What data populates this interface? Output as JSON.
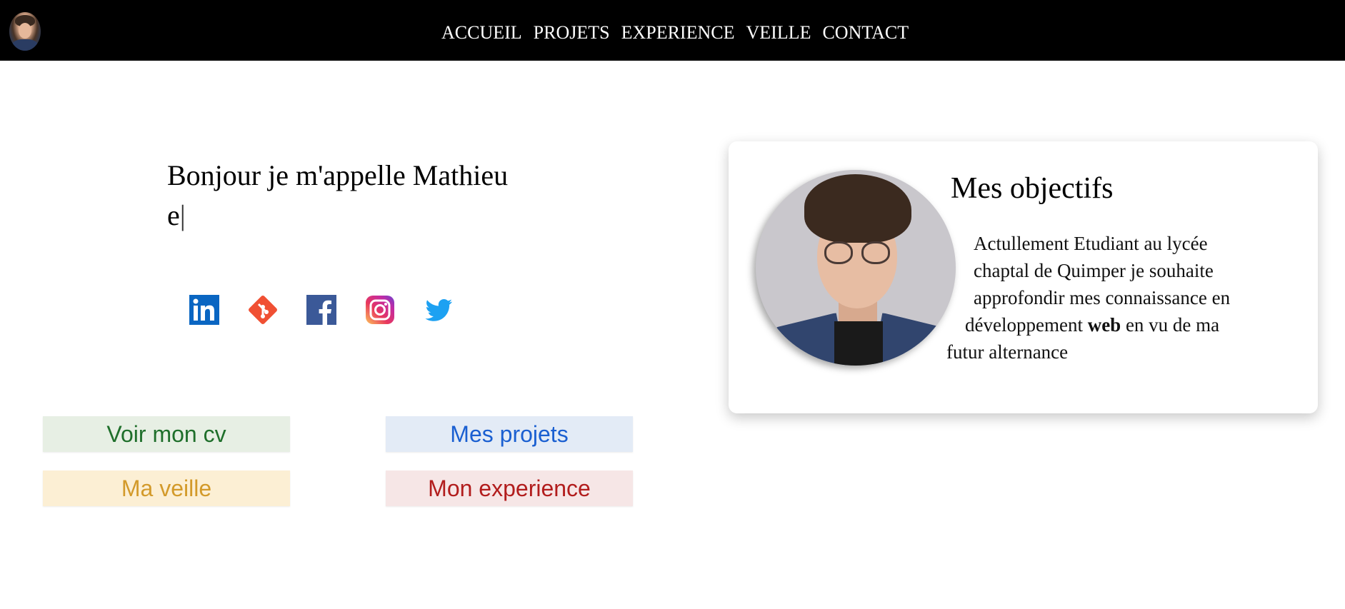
{
  "nav": {
    "items": [
      {
        "label": "ACCUEIL"
      },
      {
        "label": "PROJETS"
      },
      {
        "label": "EXPERIENCE"
      },
      {
        "label": "VEILLE"
      },
      {
        "label": "CONTACT"
      }
    ]
  },
  "intro": {
    "greeting": "Bonjour je m'appelle Mathieu",
    "typed": "e",
    "cursor": "|"
  },
  "socials": [
    {
      "name": "linkedin-icon",
      "color": "#0a66c2"
    },
    {
      "name": "git-icon",
      "color": "#f05033"
    },
    {
      "name": "facebook-icon",
      "color": "#3b5998"
    },
    {
      "name": "instagram-icon",
      "color": "#d6249f"
    },
    {
      "name": "twitter-icon",
      "color": "#1da1f2"
    }
  ],
  "buttons": {
    "cv": "Voir mon cv",
    "projets": "Mes projets",
    "veille": "Ma veille",
    "experience": "Mon experience"
  },
  "objectives": {
    "title": "Mes objectifs",
    "line1": "Actullement Etudiant au lycée",
    "line2": "chaptal de Quimper je souhaite",
    "line3": "approfondir mes connaissance en",
    "line4_pre": "développement ",
    "line4_bold": "web",
    "line4_post": " en vu de ma",
    "line5": "futur alternance"
  }
}
